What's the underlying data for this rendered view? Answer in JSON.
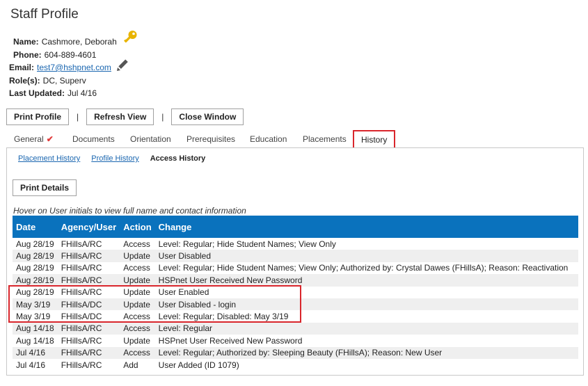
{
  "page": {
    "title": "Staff Profile"
  },
  "profile": {
    "name_label": "Name:",
    "name": "Cashmore, Deborah",
    "phone_label": "Phone:",
    "phone": "604-889-4601",
    "email_label": "Email:",
    "email": "test7@hshpnet.com",
    "roles_label": "Role(s):",
    "roles": "DC, Superv",
    "updated_label": "Last Updated:",
    "updated": "Jul 4/16"
  },
  "toolbar": {
    "print_profile": "Print Profile",
    "refresh_view": "Refresh View",
    "close_window": "Close Window",
    "separator": "|"
  },
  "tabs": [
    "General",
    "Documents",
    "Orientation",
    "Prerequisites",
    "Education",
    "Placements",
    "History"
  ],
  "active_tab": "History",
  "subtabs": {
    "placement_history": "Placement History",
    "profile_history": "Profile History",
    "access_history": "Access History"
  },
  "print_details": "Print Details",
  "hint": "Hover on User initials to view full name and contact information",
  "table": {
    "headers": [
      "Date",
      "Agency/User",
      "Action",
      "Change"
    ],
    "rows": [
      [
        "Aug 28/19",
        "FHillsA/RC",
        "Access",
        "Level: Regular; Hide Student Names; View Only"
      ],
      [
        "Aug 28/19",
        "FHillsA/RC",
        "Update",
        "User Disabled"
      ],
      [
        "Aug 28/19",
        "FHillsA/RC",
        "Access",
        "Level: Regular; Hide Student Names; View Only; Authorized by: Crystal Dawes (FHillsA); Reason: Reactivation"
      ],
      [
        "Aug 28/19",
        "FHillsA/RC",
        "Update",
        "HSPnet User Received New Password"
      ],
      [
        "Aug 28/19",
        "FHillsA/RC",
        "Update",
        "User Enabled"
      ],
      [
        "May 3/19",
        "FHillsA/DC",
        "Update",
        "User Disabled - login"
      ],
      [
        "May 3/19",
        "FHillsA/DC",
        "Access",
        "Level: Regular; Disabled: May 3/19"
      ],
      [
        "Aug 14/18",
        "FHillsA/RC",
        "Access",
        "Level: Regular"
      ],
      [
        "Aug 14/18",
        "FHillsA/RC",
        "Update",
        "HSPnet User Received New Password"
      ],
      [
        "Jul 4/16",
        "FHillsA/RC",
        "Access",
        "Level: Regular; Authorized by: Sleeping Beauty (FHillsA); Reason: New User"
      ],
      [
        "Jul 4/16",
        "FHillsA/RC",
        "Add",
        "User Added (ID 1079)"
      ]
    ]
  },
  "colors": {
    "header_blue": "#0a72bd",
    "highlight_red": "#d9262c",
    "key_gold": "#e8b400",
    "link_blue": "#1a66b0"
  },
  "icons": {
    "key": "key-icon",
    "edit": "pencil-icon",
    "check": "checkmark-icon"
  }
}
